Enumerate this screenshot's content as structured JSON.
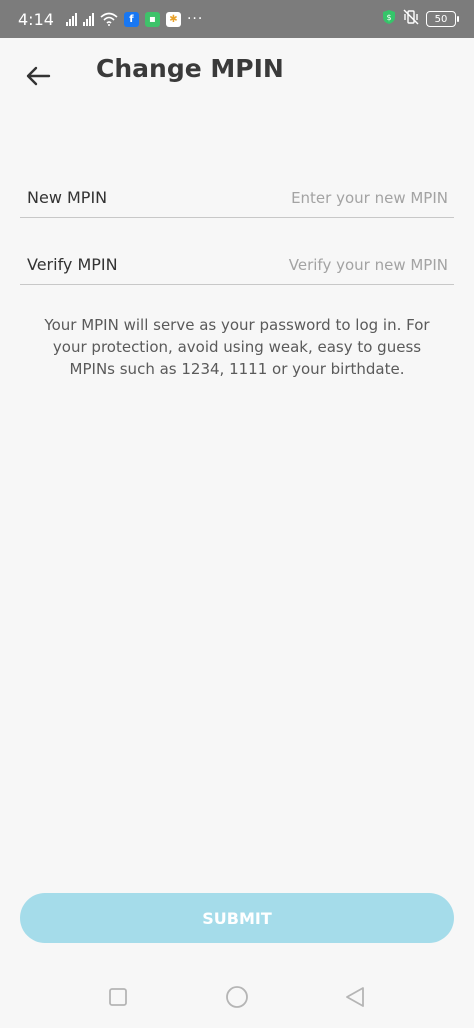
{
  "status_bar": {
    "time": "4:14",
    "more": "···",
    "battery": "50",
    "app_icons": [
      {
        "name": "facebook-icon",
        "glyph": "f",
        "color": "#1877f2"
      },
      {
        "name": "messenger-icon",
        "glyph": "▪",
        "color": "#3ec26a"
      },
      {
        "name": "photos-icon",
        "glyph": "✱",
        "color": "#e9a22a"
      }
    ],
    "shield_color": "#35c56a"
  },
  "header": {
    "title": "Change MPIN",
    "back_icon": "arrow-left-icon"
  },
  "form": {
    "new_mpin": {
      "label": "New MPIN",
      "placeholder": "Enter your new MPIN",
      "value": ""
    },
    "verify_mpin": {
      "label": "Verify MPIN",
      "placeholder": "Verify your new MPIN",
      "value": ""
    },
    "helper_text": "Your MPIN will serve as your password to log in. For your protection, avoid using weak, easy to guess MPINs such as 1234, 1111 or your birthdate."
  },
  "submit": {
    "label": "SUBMIT",
    "color": "#a5dcea"
  },
  "nav_bar": {
    "recent_icon": "square-icon",
    "home_icon": "circle-icon",
    "back_icon": "triangle-back-icon"
  }
}
